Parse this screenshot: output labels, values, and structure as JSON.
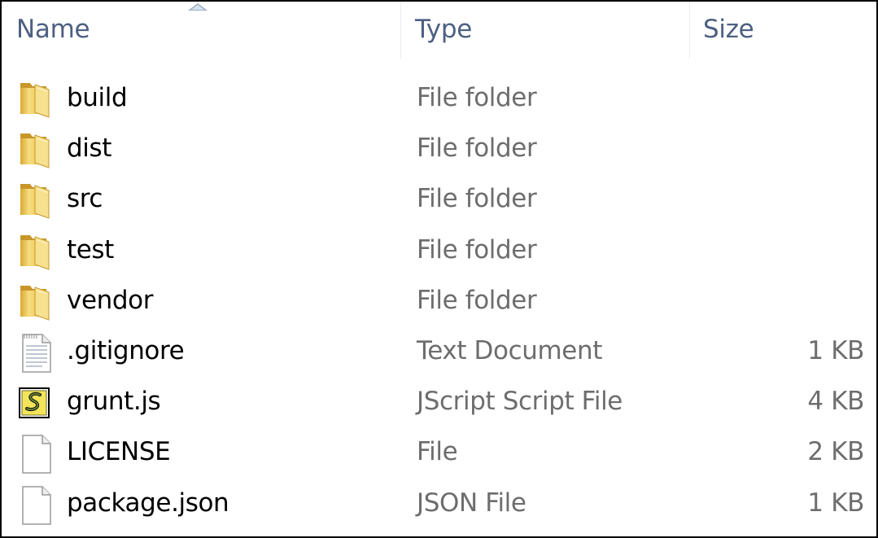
{
  "columns": {
    "name": "Name",
    "type": "Type",
    "size": "Size",
    "sort_column": "name",
    "sort_direction": "ascending"
  },
  "colors": {
    "header_text": "#4d6082",
    "name_text": "#000000",
    "detail_text": "#6d6d6d",
    "folder_yellow": "#f2cd5c"
  },
  "files": [
    {
      "name": "build",
      "type": "File folder",
      "size": "",
      "icon": "folder-icon"
    },
    {
      "name": "dist",
      "type": "File folder",
      "size": "",
      "icon": "folder-icon"
    },
    {
      "name": "src",
      "type": "File folder",
      "size": "",
      "icon": "folder-icon"
    },
    {
      "name": "test",
      "type": "File folder",
      "size": "",
      "icon": "folder-icon"
    },
    {
      "name": "vendor",
      "type": "File folder",
      "size": "",
      "icon": "folder-icon"
    },
    {
      "name": ".gitignore",
      "type": "Text Document",
      "size": "1 KB",
      "icon": "text-document-icon"
    },
    {
      "name": "grunt.js",
      "type": "JScript Script File",
      "size": "4 KB",
      "icon": "jscript-file-icon"
    },
    {
      "name": "LICENSE",
      "type": "File",
      "size": "2 KB",
      "icon": "blank-file-icon"
    },
    {
      "name": "package.json",
      "type": "JSON File",
      "size": "1 KB",
      "icon": "blank-file-icon"
    }
  ]
}
